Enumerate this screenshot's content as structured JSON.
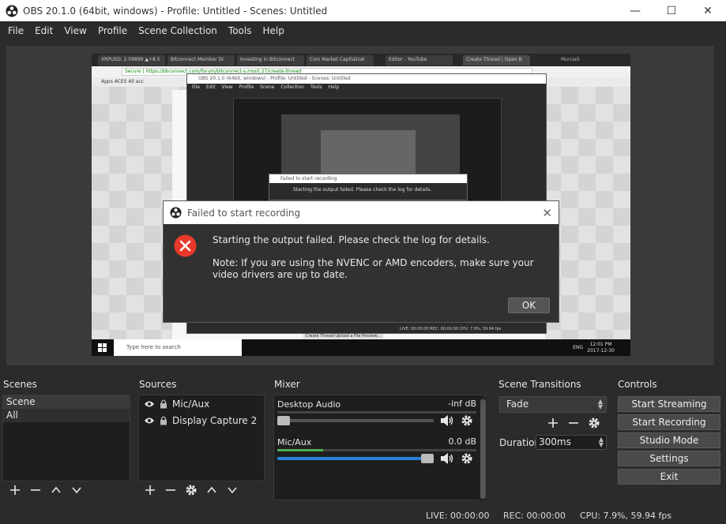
{
  "window": {
    "title": "OBS 20.1.0 (64bit, windows) - Profile: Untitled - Scenes: Untitled",
    "minimize": "—",
    "maximize": "☐",
    "close": "✕"
  },
  "menu": [
    "File",
    "Edit",
    "View",
    "Profile",
    "Scene Collection",
    "Tools",
    "Help"
  ],
  "preview": {
    "tabs": [
      "XRPUSD: 2.09899 ▲+8.5",
      "Bitconnect Member Di",
      "Investing in Bitconnect",
      "Coin Market Capitalizat",
      "Editor - YouTube",
      "Create Thread | Open B"
    ],
    "browser_user": "Murcia5",
    "address": "Secure | https://bbconnect.com/forum/bitconnect-s.mont 27/create-thread",
    "bookmarks": "Apps   ACES   All   acc",
    "nested_obs_title": "OBS 20.1.0 (64bit, windows) - Profile: Untitled - Scenes: Untitled",
    "nested_menu": "File Edit View Profile Scene Collection Tools Help",
    "nested_dialog_title": "Failed to start recording",
    "nested_dialog_text": "Starting the output failed. Please check the log for details.",
    "nested_status": "LIVE: 00:00:00   REC: 00:00:00   CPU: 7.9%, 59.94 fps",
    "page_bottom": "Create Thread   Upload a File   Preview...",
    "taskbar_search": "Type here to search",
    "taskbar_lang": "ENG",
    "taskbar_time": "12:01 PM",
    "taskbar_date": "2017-12-30"
  },
  "dialog": {
    "title": "Failed to start recording",
    "line1": "Starting the output failed.  Please check the log for details.",
    "line2": "Note: If you are using the NVENC or AMD encoders, make sure your video drivers are up to date.",
    "ok": "OK"
  },
  "scenes": {
    "title": "Scenes",
    "header": "Scene",
    "items": [
      "All"
    ]
  },
  "sources": {
    "title": "Sources",
    "items": [
      "Mic/Aux",
      "Display Capture 2"
    ]
  },
  "mixer": {
    "title": "Mixer",
    "channels": [
      {
        "name": "Desktop Audio",
        "value": "-inf dB",
        "level": 0.0,
        "volume": 0.0
      },
      {
        "name": "Mic/Aux",
        "value": "0.0 dB",
        "level": 0.23,
        "volume": 1.0
      }
    ]
  },
  "transitions": {
    "title": "Scene Transitions",
    "selected": "Fade",
    "duration_label": "Duration",
    "duration_value": "300ms"
  },
  "controls": {
    "title": "Controls",
    "buttons": [
      "Start Streaming",
      "Start Recording",
      "Studio Mode",
      "Settings",
      "Exit"
    ]
  },
  "status": {
    "live": "LIVE: 00:00:00",
    "rec": "REC: 00:00:00",
    "cpu": "CPU: 7.9%, 59.94 fps"
  },
  "colors": {
    "accent": "#2a82da",
    "error": "#e8392b",
    "meter": "#4caf50"
  }
}
